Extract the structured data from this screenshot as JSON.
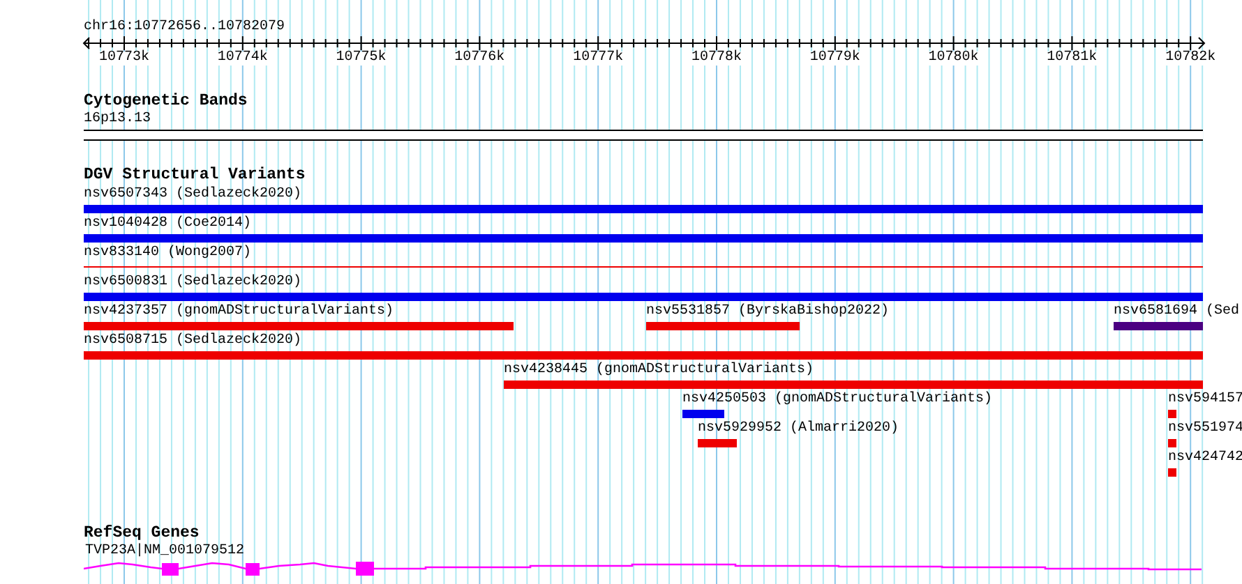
{
  "ruler": {
    "location": "chr16:10772656..10782079",
    "ticks": [
      "10773k",
      "10774k",
      "10775k",
      "10776k",
      "10777k",
      "10778k",
      "10779k",
      "10780k",
      "10781k",
      "10782k"
    ]
  },
  "tracks": [
    {
      "kind": "cytoband",
      "title": "Cytogenetic Bands",
      "features": [
        {
          "label": "16p13.13"
        }
      ]
    },
    {
      "kind": "variants",
      "title": "DGV Structural Variants",
      "features": [
        {
          "label": "nsv6507343 (Sedlazeck2020)",
          "kind": "bar",
          "color": "#0000ee"
        },
        {
          "label": "nsv1040428 (Coe2014)",
          "kind": "bar",
          "color": "#0000ee"
        },
        {
          "label": "nsv833140 (Wong2007)",
          "kind": "line",
          "color": "#ee0000"
        },
        {
          "label": "nsv6500831 (Sedlazeck2020)",
          "kind": "bar",
          "color": "#0000ee"
        },
        {
          "label": "nsv4237357 (gnomADStructuralVariants)",
          "kind": "bar",
          "color": "#ee0000"
        },
        {
          "label": "nsv5531857 (ByrskaBishop2022)",
          "kind": "bar",
          "color": "#ee0000"
        },
        {
          "label": "nsv6581694 (Sed",
          "kind": "bar",
          "color": "#4b0082"
        },
        {
          "label": "nsv6508715 (Sedlazeck2020)",
          "kind": "bar",
          "color": "#ee0000"
        },
        {
          "label": "nsv4238445 (gnomADStructuralVariants)",
          "kind": "bar",
          "color": "#ee0000"
        },
        {
          "label": "nsv4250503 (gnomADStructuralVariants)",
          "kind": "bar",
          "color": "#0000ee"
        },
        {
          "label": "nsv594157",
          "kind": "bar",
          "color": "#ee0000"
        },
        {
          "label": "nsv5929952 (Almarri2020)",
          "kind": "bar",
          "color": "#ee0000"
        },
        {
          "label": "nsv551974",
          "kind": "bar",
          "color": "#ee0000"
        },
        {
          "label": "nsv424742",
          "kind": "bar",
          "color": "#ee0000"
        }
      ]
    },
    {
      "kind": "genes",
      "title": "RefSeq Genes",
      "features": [
        {
          "label": "TVP23A|NM_001079512",
          "color": "#ff00ff"
        }
      ]
    }
  ]
}
